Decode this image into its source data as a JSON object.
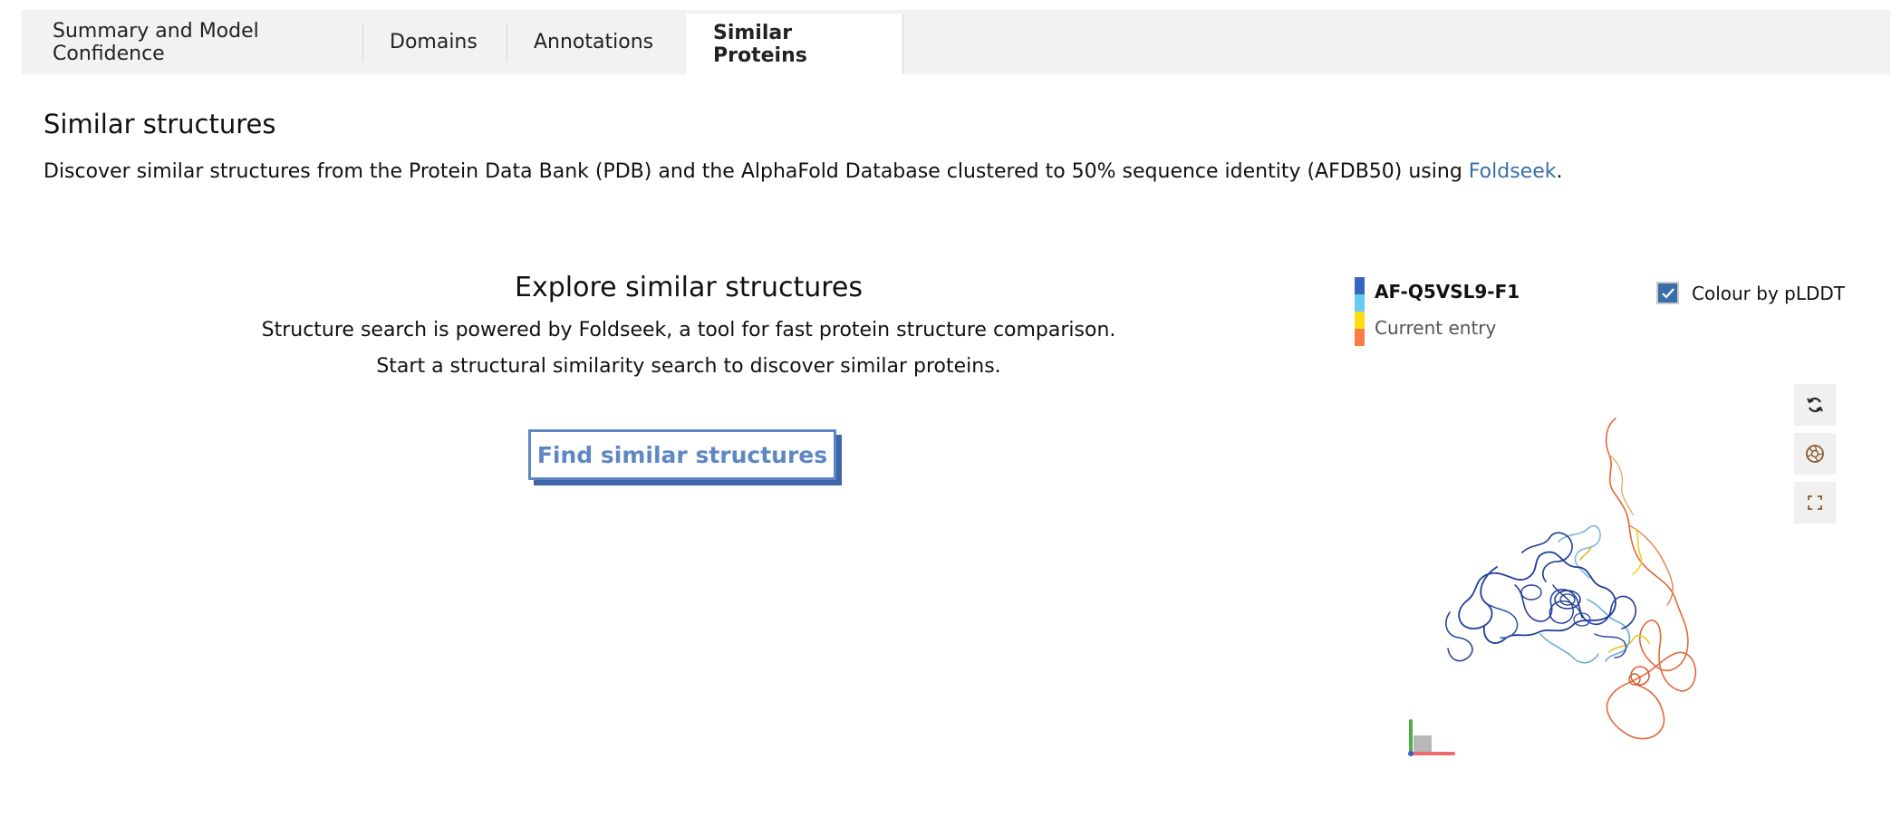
{
  "tabs": [
    {
      "label": "Summary and Model Confidence"
    },
    {
      "label": "Domains"
    },
    {
      "label": "Annotations"
    },
    {
      "label": "Similar Proteins"
    }
  ],
  "section": {
    "title": "Similar structures",
    "desc_prefix": "Discover similar structures from the Protein Data Bank (PDB) and the AlphaFold Database clustered to 50% sequence identity (AFDB50) using ",
    "link": "Foldseek",
    "desc_suffix": "."
  },
  "explore": {
    "title": "Explore similar structures",
    "line1": "Structure search is powered by Foldseek, a tool for fast protein structure comparison.",
    "line2": "Start a structural similarity search to discover similar proteins.",
    "button": "Find similar structures"
  },
  "legend": {
    "entry_id": "AF-Q5VSL9-F1",
    "entry_label": "Current entry",
    "colors": [
      "#3565c0",
      "#65cbf3",
      "#ffdb13",
      "#ff7d45"
    ]
  },
  "colour_toggle": {
    "label": "Colour by pLDDT",
    "checked": true
  },
  "viewer_controls": [
    {
      "icon": "rotate-icon"
    },
    {
      "icon": "camera-icon"
    },
    {
      "icon": "fullscreen-icon"
    }
  ],
  "colors": {
    "link": "#3b6ea8",
    "button": "#5f87c4"
  }
}
